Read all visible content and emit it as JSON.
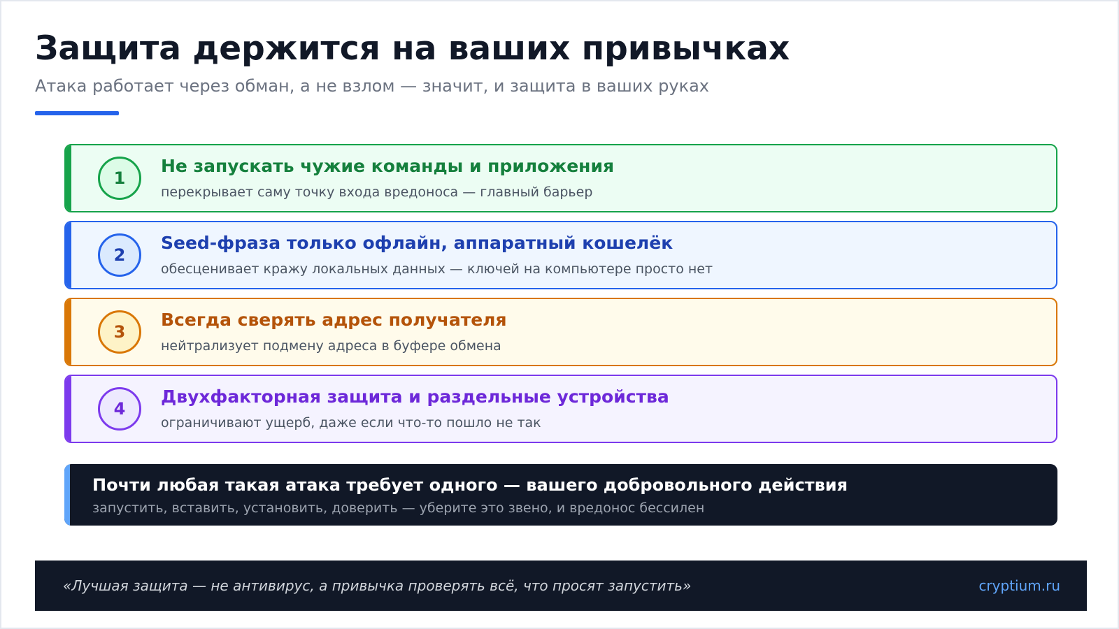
{
  "header": {
    "title": "Защита держится на ваших привычках",
    "subtitle": "Атака работает через обман, а не взлом — значит, и защита в ваших руках",
    "accent_color": "#2563eb"
  },
  "cards": [
    {
      "number": "1",
      "title": "Не запускать чужие команды и приложения",
      "description": "перекрывает саму точку входа вредоноса — главный барьер",
      "accent_color": "#16a34a",
      "text_color": "#15803d",
      "background": "#ecfdf3",
      "badge_background": "#dcfce7"
    },
    {
      "number": "2",
      "title": "Seed-фраза только офлайн, аппаратный кошелёк",
      "description": "обесценивает кражу локальных данных — ключей на компьютере просто нет",
      "accent_color": "#2563eb",
      "text_color": "#1e40af",
      "background": "#eff6ff",
      "badge_background": "#dbeafe"
    },
    {
      "number": "3",
      "title": "Всегда сверять адрес получателя",
      "description": "нейтрализует подмену адреса в буфере обмена",
      "accent_color": "#d97706",
      "text_color": "#b45309",
      "background": "#fffbeb",
      "badge_background": "#fef3c7"
    },
    {
      "number": "4",
      "title": "Двухфакторная защита и раздельные устройства",
      "description": "ограничивают ущерб, даже если что-то пошло не так",
      "accent_color": "#7c3aed",
      "text_color": "#6d28d9",
      "background": "#f5f3ff",
      "badge_background": "#ede9fe"
    }
  ],
  "callout": {
    "title": "Почти любая такая атака требует одного — вашего добровольного действия",
    "description": "запустить, вставить, установить, доверить — уберите это звено, и вредонос бессилен",
    "accent_color": "#60a5fa"
  },
  "footer": {
    "quote": "«Лучшая защита — не антивирус, а привычка проверять всё, что просят запустить»",
    "site": "cryptium.ru",
    "site_color": "#60a5fa"
  }
}
